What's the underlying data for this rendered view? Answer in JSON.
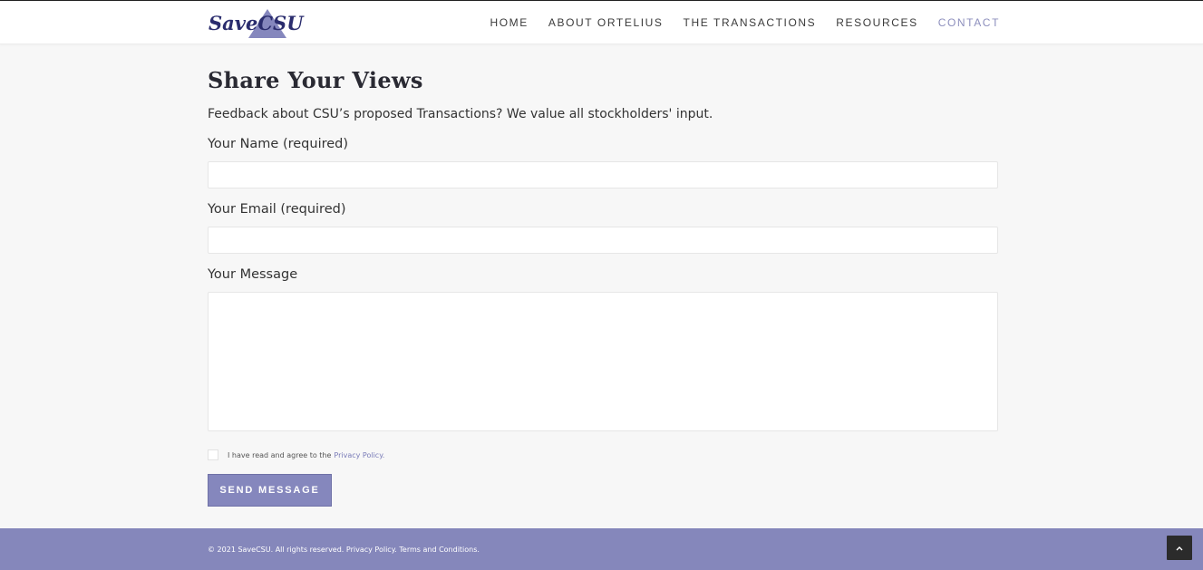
{
  "brand": {
    "name": "SaveCSU",
    "accent_color": "#8587bd",
    "logo_color": "#2b2d6e"
  },
  "nav": {
    "items": [
      {
        "label": "HOME"
      },
      {
        "label": "ABOUT ORTELIUS"
      },
      {
        "label": "THE TRANSACTIONS"
      },
      {
        "label": "RESOURCES"
      },
      {
        "label": "CONTACT",
        "active": true
      }
    ]
  },
  "page": {
    "title": "Share Your Views",
    "intro": "Feedback about CSU’s proposed Transactions? We value all stockholders' input."
  },
  "form": {
    "name_label": "Your Name (required)",
    "name_value": "",
    "email_label": "Your Email (required)",
    "email_value": "",
    "message_label": "Your Message",
    "message_value": "",
    "consent_text": "I have read and agree to the",
    "consent_link": "Privacy Policy.",
    "consent_checked": false,
    "submit_label": "SEND MESSAGE"
  },
  "footer": {
    "copyright": "© 2021 SaveCSU. All rights reserved.",
    "privacy_link": "Privacy Policy.",
    "terms_link": "Terms and Conditions.",
    "scroll_top_icon": "chevron-up-icon"
  }
}
